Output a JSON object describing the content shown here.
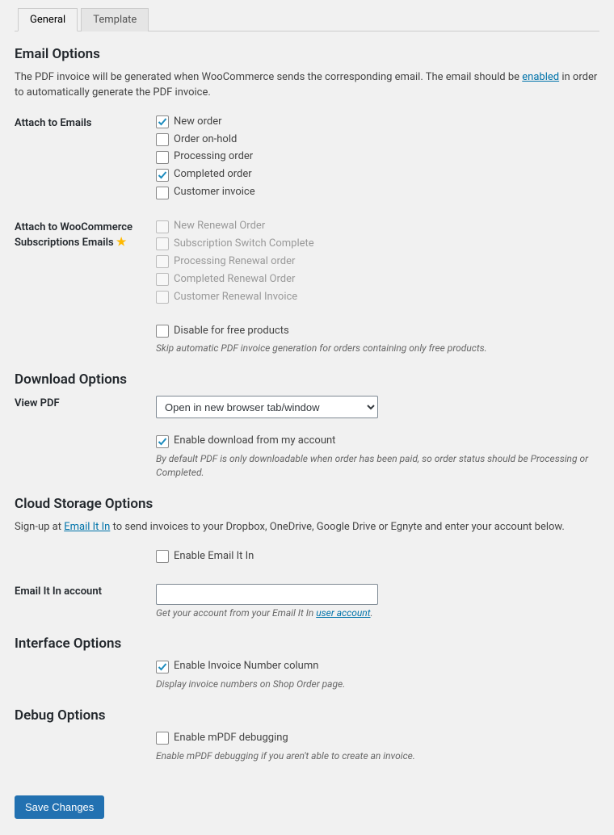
{
  "tabs": {
    "general": "General",
    "template": "Template"
  },
  "email_options": {
    "heading": "Email Options",
    "desc_pre": "The PDF invoice will be generated when WooCommerce sends the corresponding email. The email should be ",
    "desc_link": "enabled",
    "desc_post": " in order to automatically generate the PDF invoice.",
    "attach_label": "Attach to Emails",
    "attach_items": [
      {
        "label": "New order",
        "checked": true
      },
      {
        "label": "Order on-hold",
        "checked": false
      },
      {
        "label": "Processing order",
        "checked": false
      },
      {
        "label": "Completed order",
        "checked": true
      },
      {
        "label": "Customer invoice",
        "checked": false
      }
    ],
    "subs_label": "Attach to WooCommerce Subscriptions Emails",
    "subs_items": [
      "New Renewal Order",
      "Subscription Switch Complete",
      "Processing Renewal order",
      "Completed Renewal Order",
      "Customer Renewal Invoice"
    ],
    "disable_free_label": "Disable for free products",
    "disable_free_help": "Skip automatic PDF invoice generation for orders containing only free products."
  },
  "download_options": {
    "heading": "Download Options",
    "view_pdf_label": "View PDF",
    "view_pdf_value": "Open in new browser tab/window",
    "enable_download_label": "Enable download from my account",
    "enable_download_help": "By default PDF is only downloadable when order has been paid, so order status should be Processing or Completed."
  },
  "cloud_options": {
    "heading": "Cloud Storage Options",
    "signup_pre": "Sign-up at ",
    "signup_link": "Email It In",
    "signup_post": " to send invoices to your Dropbox, OneDrive, Google Drive or Egnyte and enter your account below.",
    "enable_label": "Enable Email It In",
    "account_label": "Email It In account",
    "account_value": "",
    "account_help_pre": "Get your account from your Email It In ",
    "account_help_link": "user account",
    "account_help_post": "."
  },
  "interface_options": {
    "heading": "Interface Options",
    "enable_col_label": "Enable Invoice Number column",
    "enable_col_help": "Display invoice numbers on Shop Order page."
  },
  "debug_options": {
    "heading": "Debug Options",
    "enable_label": "Enable mPDF debugging",
    "enable_help": "Enable mPDF debugging if you aren't able to create an invoice."
  },
  "save_button": "Save Changes"
}
